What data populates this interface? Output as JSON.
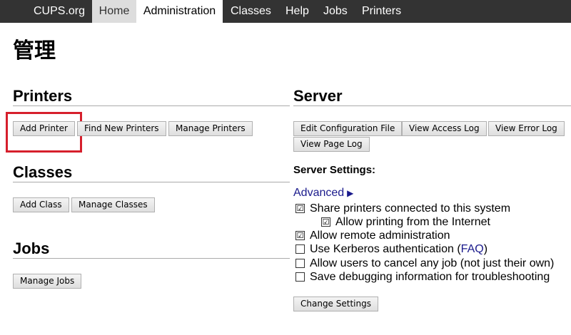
{
  "nav": {
    "tabs": [
      {
        "label": "CUPS.org"
      },
      {
        "label": "Home"
      },
      {
        "label": "Administration"
      },
      {
        "label": "Classes"
      },
      {
        "label": "Help"
      },
      {
        "label": "Jobs"
      },
      {
        "label": "Printers"
      }
    ],
    "active_tab": "Administration"
  },
  "page_title": "管理",
  "printers": {
    "heading": "Printers",
    "buttons": [
      "Add Printer",
      "Find New Printers",
      "Manage Printers"
    ]
  },
  "classes": {
    "heading": "Classes",
    "buttons": [
      "Add Class",
      "Manage Classes"
    ]
  },
  "jobs": {
    "heading": "Jobs",
    "buttons": [
      "Manage Jobs"
    ]
  },
  "server": {
    "heading": "Server",
    "buttons": [
      "Edit Configuration File",
      "View Access Log",
      "View Error Log",
      "View Page Log"
    ],
    "settings_heading": "Server Settings:",
    "advanced_label": "Advanced",
    "advanced_arrow": "▶",
    "settings": [
      {
        "label": "Share printers connected to this system",
        "checked": true
      },
      {
        "label": "Allow printing from the Internet",
        "checked": true
      },
      {
        "label": "Allow remote administration",
        "checked": true
      },
      {
        "label_prefix": "Use Kerberos authentication (",
        "link": "FAQ",
        "label_suffix": ")",
        "checked": false
      },
      {
        "label": "Allow users to cancel any job (not just their own)",
        "checked": false
      },
      {
        "label": "Save debugging information for troubleshooting",
        "checked": false
      }
    ],
    "submit_label": "Change Settings"
  },
  "check_glyph": "☑",
  "colors": {
    "nav_bg": "#333333",
    "highlight": "#d61f2c",
    "link": "#1a1a8c"
  }
}
